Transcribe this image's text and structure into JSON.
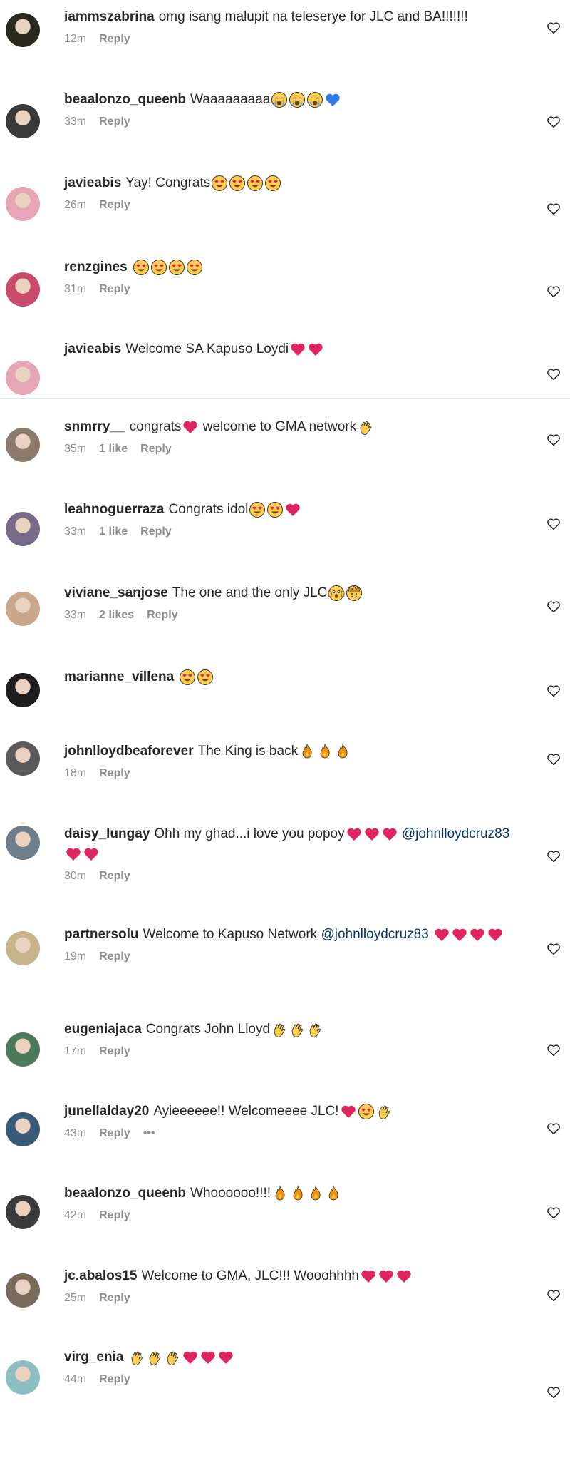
{
  "comments": [
    {
      "user": "iammszabrina",
      "text": "omg isang malupit na teleserye for JLC and BA!!!!!!!",
      "emoji": [],
      "time": "12m",
      "likes": "",
      "reply": "Reply",
      "avatar": "#2a2a20"
    },
    {
      "user": "beaalonzo_queenb",
      "text": "Waaaaaaaaa",
      "emoji": [
        "cry",
        "cry",
        "cry",
        "blue-heart"
      ],
      "time": "33m",
      "likes": "",
      "reply": "Reply",
      "avatar": "#3a3a3a"
    },
    {
      "user": "javieabis",
      "text": "Yay! Congrats",
      "emoji": [
        "heart-eyes",
        "heart-eyes",
        "heart-eyes",
        "heart-eyes"
      ],
      "time": "26m",
      "likes": "",
      "reply": "Reply",
      "avatar": "#e7a6b6"
    },
    {
      "user": "renzgines",
      "text": "",
      "emoji": [
        "heart-eyes",
        "heart-eyes",
        "heart-eyes",
        "heart-eyes"
      ],
      "time": "31m",
      "likes": "",
      "reply": "Reply",
      "avatar": "#c84b6a"
    },
    {
      "user": "javieabis",
      "text": "Welcome SA Kapuso Loydi",
      "emoji": [
        "red-heart",
        "red-heart"
      ],
      "time": "",
      "likes": "",
      "reply": "",
      "avatar": "#e7a6b6"
    },
    {
      "user": "snmrry__",
      "text": "congrats",
      "emoji": [
        "red-heart"
      ],
      "text2": " welcome to GMA network",
      "emoji2": [
        "clap"
      ],
      "time": "35m",
      "likes": "1 like",
      "reply": "Reply",
      "avatar": "#8c7b6b"
    },
    {
      "user": "leahnoguerraza",
      "text": "Congrats idol",
      "emoji": [
        "heart-eyes",
        "heart-eyes",
        "red-heart"
      ],
      "time": "33m",
      "likes": "1 like",
      "reply": "Reply",
      "avatar": "#7a6a8a"
    },
    {
      "user": "viviane_sanjose",
      "text": "The one and the only JLC",
      "emoji": [
        "scream",
        "crown-face"
      ],
      "time": "33m",
      "likes": "2 likes",
      "reply": "Reply",
      "avatar": "#c9a68c"
    },
    {
      "user": "marianne_villena",
      "text": "",
      "emoji": [
        "heart-eyes",
        "heart-eyes"
      ],
      "time": "",
      "likes": "",
      "reply": "",
      "avatar": "#1e1e1e"
    },
    {
      "user": "johnlloydbeaforever",
      "text": "The King is back",
      "emoji": [
        "fire",
        "fire",
        "fire"
      ],
      "time": "18m",
      "likes": "",
      "reply": "Reply",
      "avatar": "#5a5a5a"
    },
    {
      "user": "daisy_lungay",
      "text": "Ohh my ghad...i love you popoy",
      "emoji": [
        "red-heart",
        "red-heart",
        "red-heart"
      ],
      "mention": "@johnlloydcruz83",
      "emoji3": [
        "red-heart",
        "red-heart"
      ],
      "time": "30m",
      "likes": "",
      "reply": "Reply",
      "avatar": "#6b7e8a"
    },
    {
      "user": "partnersolu",
      "text": "Welcome to Kapuso Network",
      "mention": "@johnlloydcruz83",
      "emoji3": [
        "red-heart",
        "red-heart",
        "red-heart",
        "red-heart"
      ],
      "emoji": [],
      "time": "19m",
      "likes": "",
      "reply": "Reply",
      "avatar": "#c8b48a"
    },
    {
      "user": "eugeniajaca",
      "text": "Congrats John Lloyd",
      "emoji": [
        "clap",
        "clap",
        "clap"
      ],
      "time": "17m",
      "likes": "",
      "reply": "Reply",
      "avatar": "#4a7a5a"
    },
    {
      "user": "junellalday20",
      "text": "Ayieeeeee!! Welcomeeee JLC!",
      "emoji": [
        "red-heart",
        "heart-eyes",
        "vulcan"
      ],
      "time": "43m",
      "likes": "",
      "reply": "Reply",
      "more": "•••",
      "avatar": "#3a5a7a"
    },
    {
      "user": "beaalonzo_queenb",
      "text": "Whoooooo!!!!",
      "emoji": [
        "fire",
        "fire",
        "fire",
        "fire"
      ],
      "time": "42m",
      "likes": "",
      "reply": "Reply",
      "avatar": "#3a3a3a"
    },
    {
      "user": "jc.abalos15",
      "text": "Welcome to GMA, JLC!!! Wooohhhh",
      "emoji": [
        "red-heart",
        "red-heart",
        "red-heart"
      ],
      "time": "25m",
      "likes": "",
      "reply": "Reply",
      "avatar": "#7a6a5a"
    },
    {
      "user": "virg_enia",
      "text": "",
      "emoji": [
        "clap",
        "clap",
        "clap",
        "red-heart",
        "red-heart",
        "red-heart"
      ],
      "time": "44m",
      "likes": "",
      "reply": "Reply",
      "avatar": "#8abec0"
    }
  ],
  "colors": {
    "username": "#262626",
    "meta": "#8e8e8e",
    "mention": "#00376b",
    "heart": "#262626"
  }
}
